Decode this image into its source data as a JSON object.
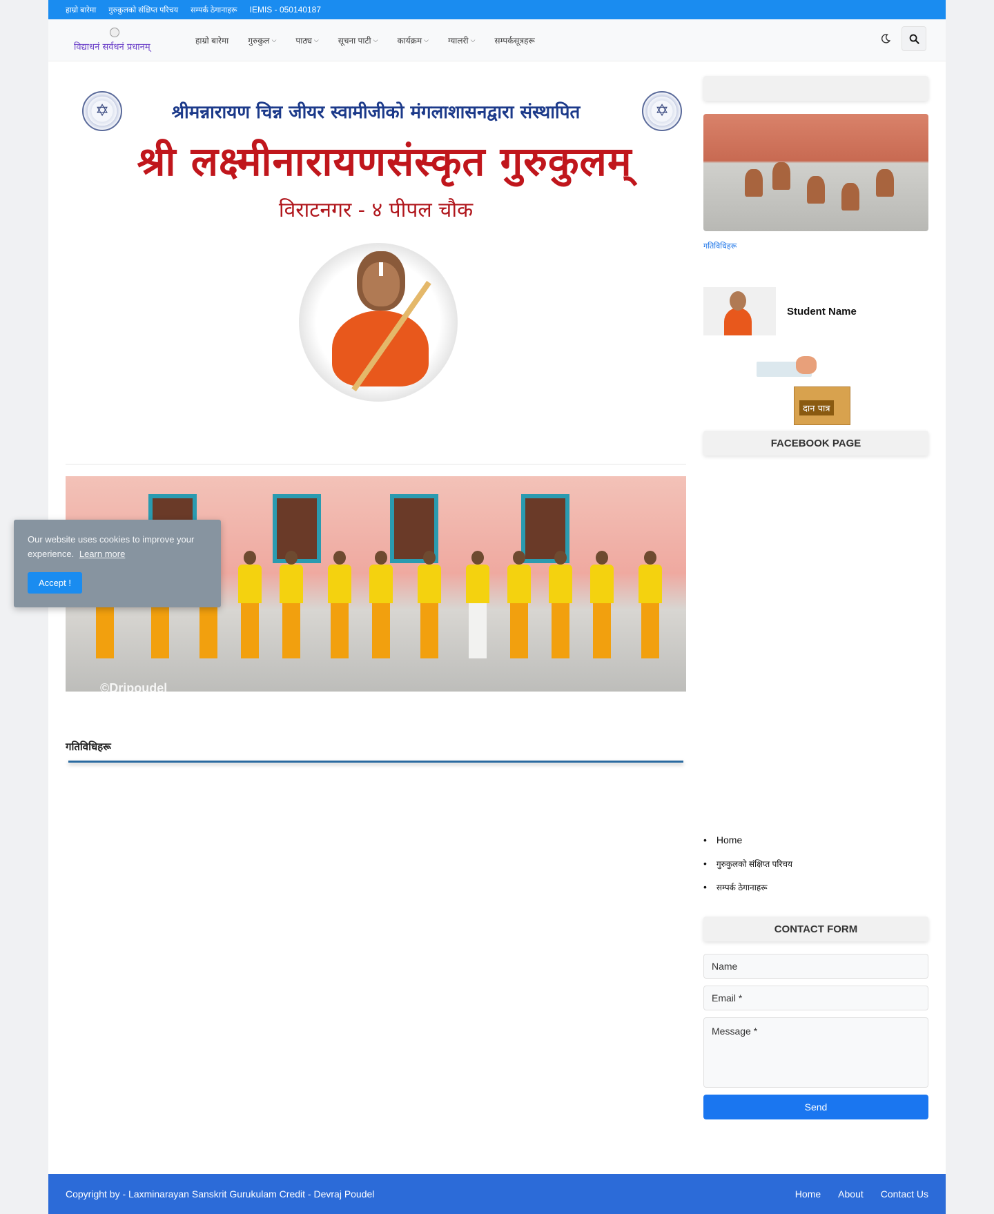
{
  "topbar": {
    "links": [
      "हाम्रो बारेमा",
      "गुरुकुलको संक्षिप्त परिचय",
      "सम्पर्क ठेगानाहरू"
    ],
    "iemis": "IEMIS - 050140187"
  },
  "header": {
    "logo_text": "विद्याधनं सर्वधनं प्रधानम्",
    "nav": [
      {
        "label": "हाम्रो बारेमा",
        "dropdown": false
      },
      {
        "label": "गुरुकुल",
        "dropdown": true
      },
      {
        "label": "पाठ्य",
        "dropdown": true
      },
      {
        "label": "सूचना पाटी",
        "dropdown": true
      },
      {
        "label": "कार्यक्रम",
        "dropdown": true
      },
      {
        "label": "ग्यालरी",
        "dropdown": true
      },
      {
        "label": "सम्पर्कसूत्रहरू",
        "dropdown": false
      }
    ]
  },
  "banner": {
    "line1": "श्रीमन्नारायण चिन्न जीयर स्वामीजीको मंगलाशासनद्वारा संस्थापित",
    "line2": "श्री लक्ष्मीनारायणसंस्कृत गुरुकुलम्",
    "line3": "विराटनगर - ४ पीपल चौक"
  },
  "photo": {
    "watermark": "©Dripoudel"
  },
  "section": {
    "title": "गतिविधिहरू"
  },
  "sidebar": {
    "photo_caption": "गतिविधिहरू",
    "student_name": "Student Name",
    "donation_label": "दान पात्र",
    "facebook_title": "FACEBOOK PAGE",
    "links": [
      "Home",
      "गुरुकुलको संक्षिप्त परिचय",
      "सम्पर्क ठेगानाहरू"
    ],
    "contact_title": "CONTACT FORM",
    "form": {
      "name_placeholder": "Name",
      "email_placeholder": "Email *",
      "message_placeholder": "Message *",
      "send_label": "Send"
    }
  },
  "footer": {
    "copyright": "Copyright by - Laxminarayan Sanskrit Gurukulam Credit - Devraj Poudel",
    "links": [
      "Home",
      "About",
      "Contact Us"
    ]
  },
  "cookie": {
    "text": "Our website uses cookies to improve your experience.",
    "learn_more": "Learn more",
    "accept": "Accept !"
  },
  "colors": {
    "topbar": "#1a8cf0",
    "banner_blue": "#1c3a8a",
    "banner_red": "#c0161c",
    "send_button": "#1a76f0",
    "footer": "#2c6bd8",
    "cookie_bg": "#8794a0"
  },
  "icons": [
    "moon-icon",
    "search-icon",
    "chevron-down-icon"
  ]
}
